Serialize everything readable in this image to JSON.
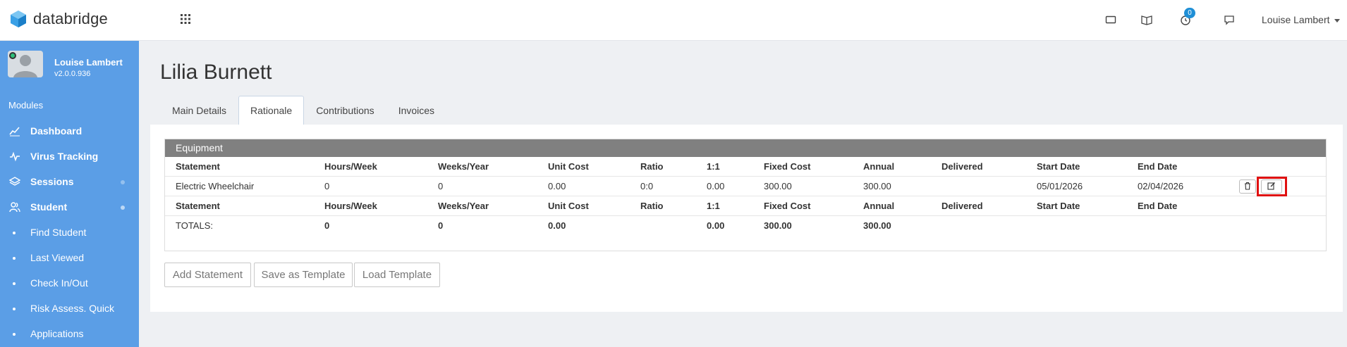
{
  "brand": {
    "name": "databridge"
  },
  "header": {
    "notification_count": "0",
    "user_menu_label": "Louise Lambert"
  },
  "sidebar": {
    "profile": {
      "name": "Louise Lambert",
      "version": "v2.0.0.936"
    },
    "modules_label": "Modules",
    "items": [
      {
        "label": "Dashboard",
        "icon": "chart-line-icon"
      },
      {
        "label": "Virus Tracking",
        "icon": "pulse-icon"
      },
      {
        "label": "Sessions",
        "icon": "layers-icon"
      },
      {
        "label": "Student",
        "icon": "users-icon"
      }
    ],
    "sub_items": [
      {
        "label": "Find Student"
      },
      {
        "label": "Last Viewed"
      },
      {
        "label": "Check In/Out"
      },
      {
        "label": "Risk Assess. Quick"
      },
      {
        "label": "Applications"
      }
    ]
  },
  "page": {
    "title": "Lilia Burnett"
  },
  "tabs": [
    {
      "label": "Main Details",
      "active": false
    },
    {
      "label": "Rationale",
      "active": true
    },
    {
      "label": "Contributions",
      "active": false
    },
    {
      "label": "Invoices",
      "active": false
    }
  ],
  "equipment": {
    "section_title": "Equipment",
    "columns": [
      "Statement",
      "Hours/Week",
      "Weeks/Year",
      "Unit Cost",
      "Ratio",
      "1:1",
      "Fixed Cost",
      "Annual",
      "Delivered",
      "Start Date",
      "End Date"
    ],
    "rows": [
      {
        "statement": "Electric Wheelchair",
        "hours_week": "0",
        "weeks_year": "0",
        "unit_cost": "0.00",
        "ratio": "0:0",
        "one_to_one": "0.00",
        "fixed_cost": "300.00",
        "annual": "300.00",
        "delivered": "",
        "start_date": "05/01/2026",
        "end_date": "02/04/2026"
      }
    ],
    "totals": {
      "label": "TOTALS:",
      "hours_week": "0",
      "weeks_year": "0",
      "unit_cost": "0.00",
      "one_to_one": "0.00",
      "fixed_cost": "300.00",
      "annual": "300.00"
    }
  },
  "actions": {
    "add_statement": "Add Statement",
    "save_template": "Save as Template",
    "load_template": "Load Template"
  },
  "colors": {
    "sidebar": "#5b9ee6",
    "accent": "#1f8fd6",
    "highlight": "#e01010",
    "section_header": "#808080"
  }
}
